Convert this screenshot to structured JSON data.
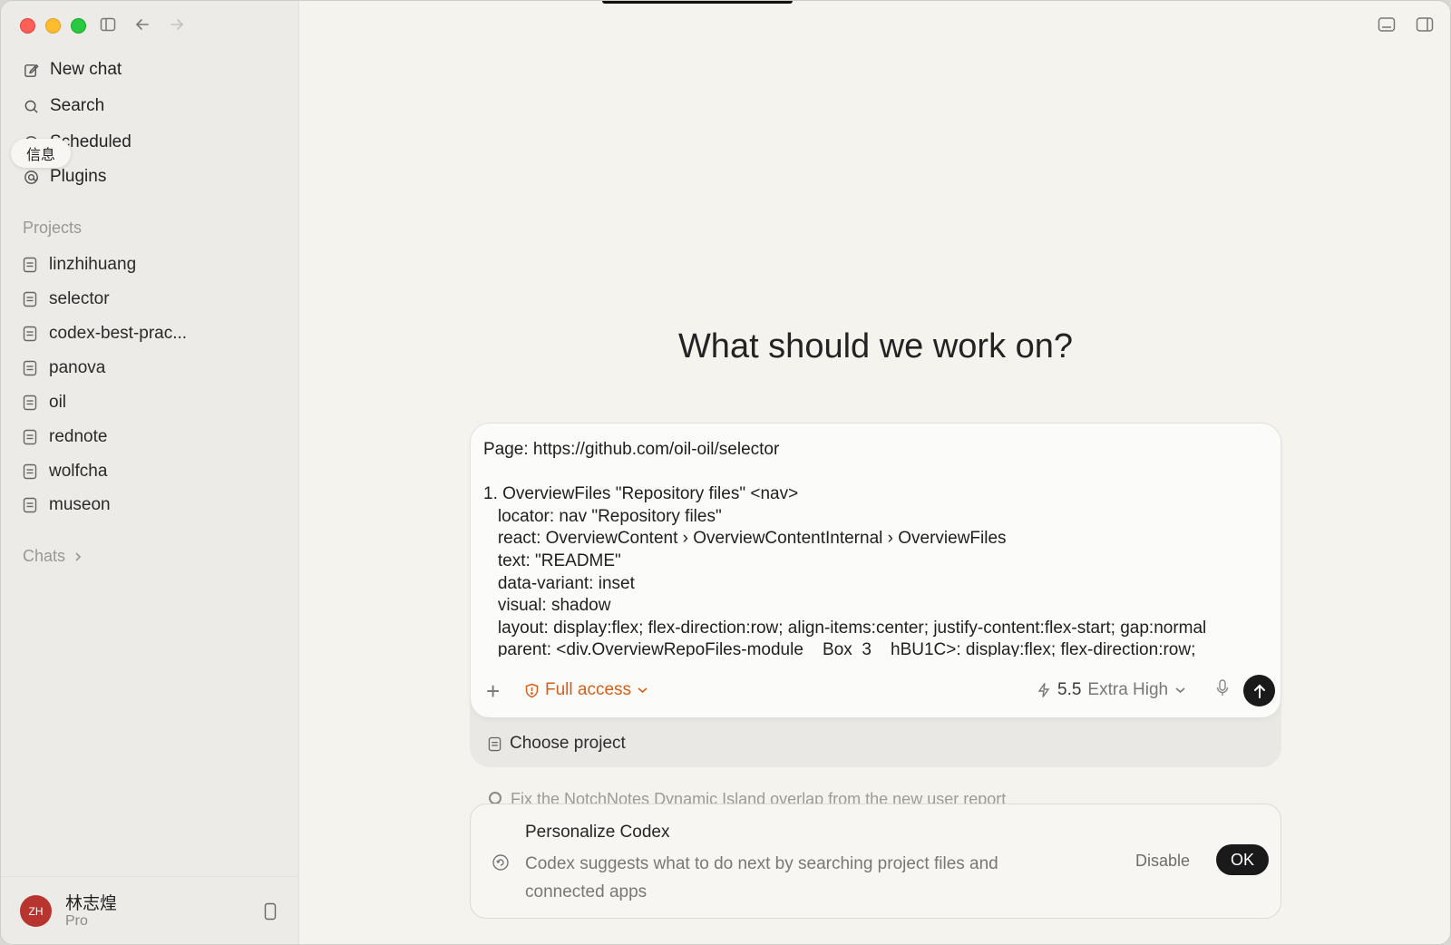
{
  "sidebar": {
    "nav": [
      {
        "label": "New chat",
        "icon": "new-chat-icon"
      },
      {
        "label": "Search",
        "icon": "search-icon"
      },
      {
        "label": "Scheduled",
        "icon": "clock-icon"
      },
      {
        "label": "Plugins",
        "icon": "at-icon"
      }
    ],
    "tooltip": "信息",
    "projects_label": "Projects",
    "projects": [
      "linzhihuang",
      "selector",
      "codex-best-prac...",
      "panova",
      "oil",
      "rednote",
      "wolfcha",
      "museon"
    ],
    "chats_label": "Chats",
    "user": {
      "initials": "ZH",
      "name": "林志煌",
      "plan": "Pro",
      "avatar_color": "#b8342e"
    }
  },
  "main": {
    "headline": "What should we work on?",
    "composer": {
      "text": "Page: https://github.com/oil-oil/selector\n\n1. OverviewFiles \"Repository files\" <nav>\n   locator: nav \"Repository files\"\n   react: OverviewContent › OverviewContentInternal › OverviewFiles\n   text: \"README\"\n   data-variant: inset\n   visual: shadow\n   layout: display:flex; flex-direction:row; align-items:center; justify-content:flex-start; gap:normal\n   parent: <div.OverviewRepoFiles-module__Box_3__hBU1C>: display:flex; flex-direction:row;",
      "access_label": "Full access",
      "access_color": "#d2601a",
      "model_version": "5.5",
      "model_level": "Extra High"
    },
    "choose_project": "Choose project",
    "faded_suggestion": "Fix the NotchNotes Dynamic Island overlap from the new user report",
    "personalize": {
      "title": "Personalize Codex",
      "description": "Codex suggests what to do next by searching project files and connected apps",
      "disable_label": "Disable",
      "ok_label": "OK"
    }
  }
}
